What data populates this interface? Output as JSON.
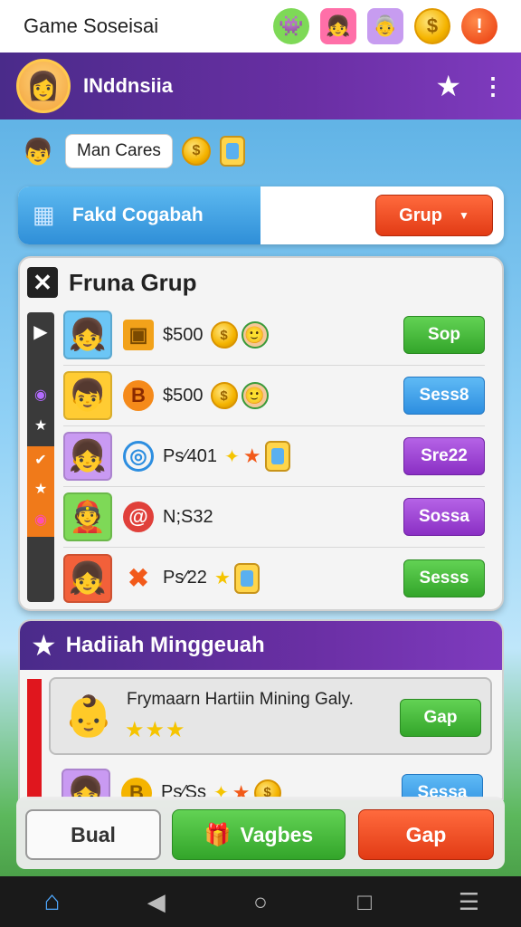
{
  "app": {
    "title": "Game Soseisai"
  },
  "top_icons": [
    "goblin-icon",
    "girl-avatar-icon",
    "grandma-avatar-icon",
    "coin-icon",
    "alert-icon"
  ],
  "header": {
    "username": "INddnsiia"
  },
  "subrow": {
    "pill_label": "Man Cares"
  },
  "filter": {
    "label": "Fakd Cogabah",
    "button_label": "Grup"
  },
  "group_panel": {
    "title": "Fruna Grup",
    "rows": [
      {
        "text": "$500",
        "button": "Sop",
        "button_color": "green"
      },
      {
        "text": "$500",
        "button": "Sess8",
        "button_color": "blue"
      },
      {
        "text": "Ps⁄401",
        "button": "Sre22",
        "button_color": "purple"
      },
      {
        "text": "N;S32",
        "button": "Sossa",
        "button_color": "purple"
      },
      {
        "text": "Ps⁄22",
        "button": "Sesss",
        "button_color": "green"
      }
    ]
  },
  "rewards": {
    "title": "Hadiiah Minggeuah",
    "card_text": "Frymaarn Hartiin Mining Galy.",
    "card_button": "Gap",
    "second_row_text": "Ps⁄Ss",
    "second_row_button": "Sessa"
  },
  "actions": {
    "left": "Bual",
    "middle": "Vagbes",
    "right": "Gap"
  },
  "colors": {
    "purple": "#6a2fa4",
    "green": "#33a52a",
    "blue": "#2d8ee0",
    "red": "#e23b15"
  }
}
